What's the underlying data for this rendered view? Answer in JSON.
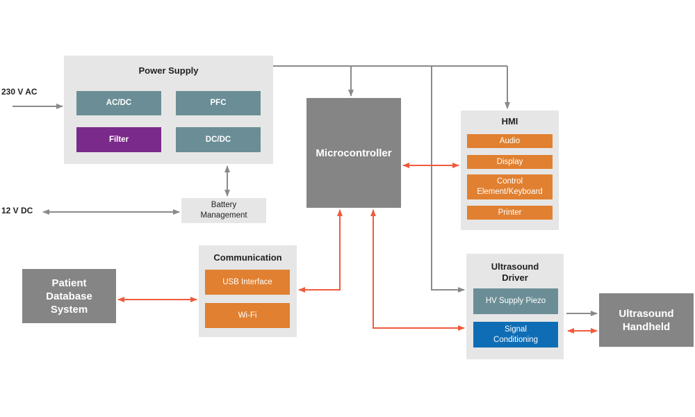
{
  "inputs": {
    "ac": "230 V AC",
    "dc": "12 V DC"
  },
  "power_supply": {
    "title": "Power Supply",
    "blocks": [
      "AC/DC",
      "PFC",
      "Filter",
      "DC/DC"
    ]
  },
  "battery": {
    "label": "Battery Management"
  },
  "microcontroller": {
    "label": "Microcontroller"
  },
  "hmi": {
    "title": "HMI",
    "items": [
      "Audio",
      "Display",
      "Control Element/Keyboard",
      "Printer"
    ]
  },
  "communication": {
    "title": "Communication",
    "items": [
      "USB Interface",
      "Wi-Fi"
    ]
  },
  "patient_db": {
    "label": "Patient Database System"
  },
  "ultrasound_driver": {
    "title": "Ultrasound Driver",
    "items": [
      "HV Supply Piezo",
      "Signal Conditioning"
    ]
  },
  "handheld": {
    "label": "Ultrasound Handheld"
  },
  "colors": {
    "power_line": "#8a8a8a",
    "data_line": "#f05a3c",
    "teal": "#6b8e96",
    "purple": "#7a2a8a",
    "orange": "#e08030",
    "blue": "#0e6db5",
    "dark": "#858585"
  }
}
